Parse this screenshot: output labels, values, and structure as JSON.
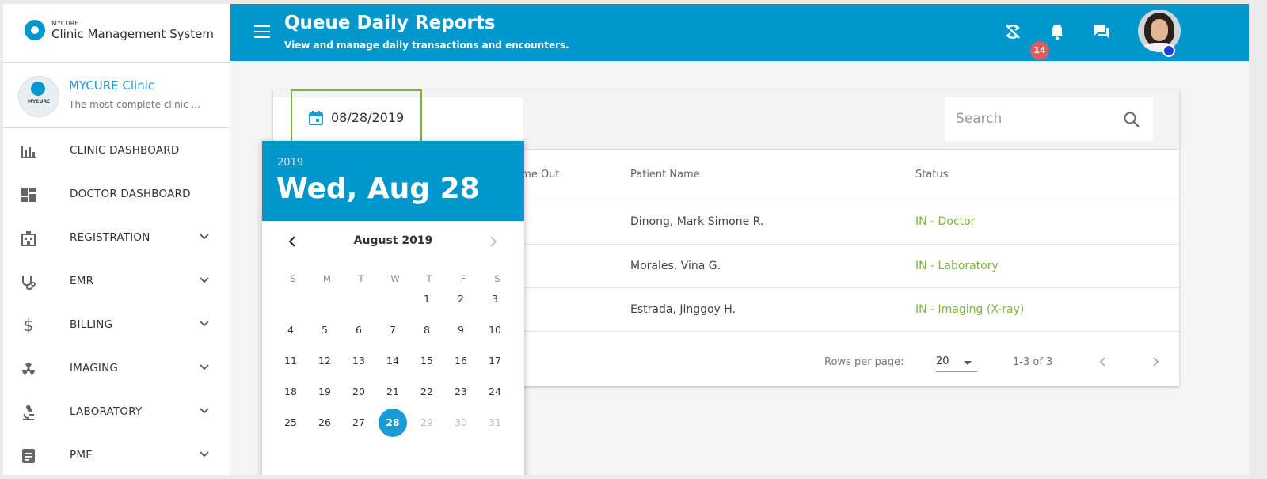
{
  "app": {
    "brand_small": "MYCURE",
    "brand_name": "Clinic Management System"
  },
  "clinic": {
    "name": "MYCURE Clinic",
    "tagline": "The most complete clinic ...",
    "logo_text": "MYCURE"
  },
  "nav": [
    {
      "label": "CLINIC DASHBOARD",
      "icon": "bar-chart-icon",
      "expandable": false
    },
    {
      "label": "DOCTOR DASHBOARD",
      "icon": "dashboard-icon",
      "expandable": false
    },
    {
      "label": "REGISTRATION",
      "icon": "hospital-icon",
      "expandable": true
    },
    {
      "label": "EMR",
      "icon": "stethoscope-icon",
      "expandable": true
    },
    {
      "label": "BILLING",
      "icon": "dollar-icon",
      "expandable": true
    },
    {
      "label": "IMAGING",
      "icon": "radiation-icon",
      "expandable": true
    },
    {
      "label": "LABORATORY",
      "icon": "microscope-icon",
      "expandable": true
    },
    {
      "label": "PME",
      "icon": "document-icon",
      "expandable": true
    }
  ],
  "header": {
    "title": "Queue Daily Reports",
    "subtitle": "View and manage daily transactions and encounters.",
    "notification_count": "14",
    "accent": "#0097cc"
  },
  "toolbar": {
    "date_value": "08/28/2019",
    "search_placeholder": "Search"
  },
  "table": {
    "columns": [
      "Time Out",
      "Patient Name",
      "Status"
    ],
    "rows": [
      {
        "patient": "Dinong, Mark Simone R.",
        "status": "IN - Doctor"
      },
      {
        "patient": "Morales, Vina G.",
        "status": "IN - Laboratory"
      },
      {
        "patient": "Estrada, Jinggoy H.",
        "status": "IN - Imaging (X-ray)"
      }
    ],
    "status_color": "#7cb342"
  },
  "pagination": {
    "rows_label": "Rows per page:",
    "rows_value": "20",
    "range": "1-3 of 3"
  },
  "picker": {
    "year": "2019",
    "date_title": "Wed, Aug 28",
    "month_label": "August 2019",
    "weekdays": [
      "S",
      "M",
      "T",
      "W",
      "T",
      "F",
      "S"
    ],
    "selected_day": 28,
    "first_weekday": 4,
    "days_in_month": 31,
    "max_enabled_day": 28
  }
}
